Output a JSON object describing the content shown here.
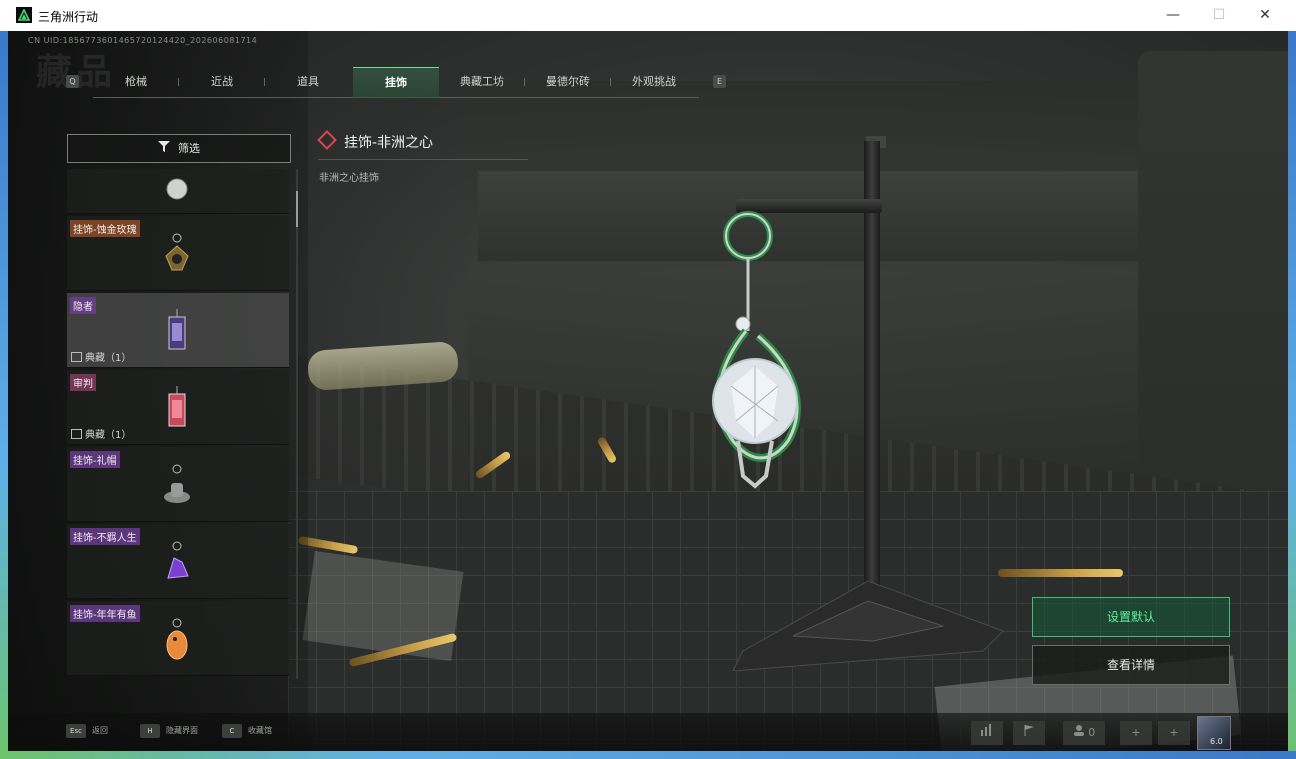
{
  "window": {
    "title": "三角洲行动",
    "minimize": "—",
    "maximize": "☐",
    "close": "✕"
  },
  "uid_text": "CN UID:1856773601465720124420_202606081714",
  "watermark": "藏品",
  "tabs": {
    "left_key": "Q",
    "right_key": "E",
    "items": [
      {
        "label": "枪械"
      },
      {
        "label": "近战"
      },
      {
        "label": "道具"
      },
      {
        "label": "挂饰",
        "active": true
      },
      {
        "label": "典藏工坊"
      },
      {
        "label": "曼德尔砖"
      },
      {
        "label": "外观挑战"
      }
    ]
  },
  "filter": {
    "label": "筛选",
    "icon": "filter-icon"
  },
  "items": [
    {
      "label": "",
      "badge": ""
    },
    {
      "label": "挂饰-蚀金玫瑰",
      "badge": ""
    },
    {
      "label": "隐者",
      "badge": "典藏（1）"
    },
    {
      "label": "审判",
      "badge": "典藏（1）"
    },
    {
      "label": "挂饰-礼帽",
      "badge": ""
    },
    {
      "label": "挂饰-不羁人生",
      "badge": ""
    },
    {
      "label": "挂饰-年年有鱼",
      "badge": ""
    }
  ],
  "detail": {
    "title": "挂饰-非洲之心",
    "subtitle": "非洲之心挂饰"
  },
  "actions": {
    "set_default": "设置默认",
    "view_details": "查看详情"
  },
  "bottom_hints": [
    {
      "key": "Esc",
      "label": "返回"
    },
    {
      "key": "H",
      "label": "隐藏界面"
    },
    {
      "key": "C",
      "label": "收藏馆"
    }
  ],
  "bottom_right": {
    "friends_count": "0",
    "avatar_label": "6.0"
  },
  "colors": {
    "accent_green": "#3fbf78",
    "active_tab": "#6fdc9a",
    "title_marker": "#e0444a"
  }
}
